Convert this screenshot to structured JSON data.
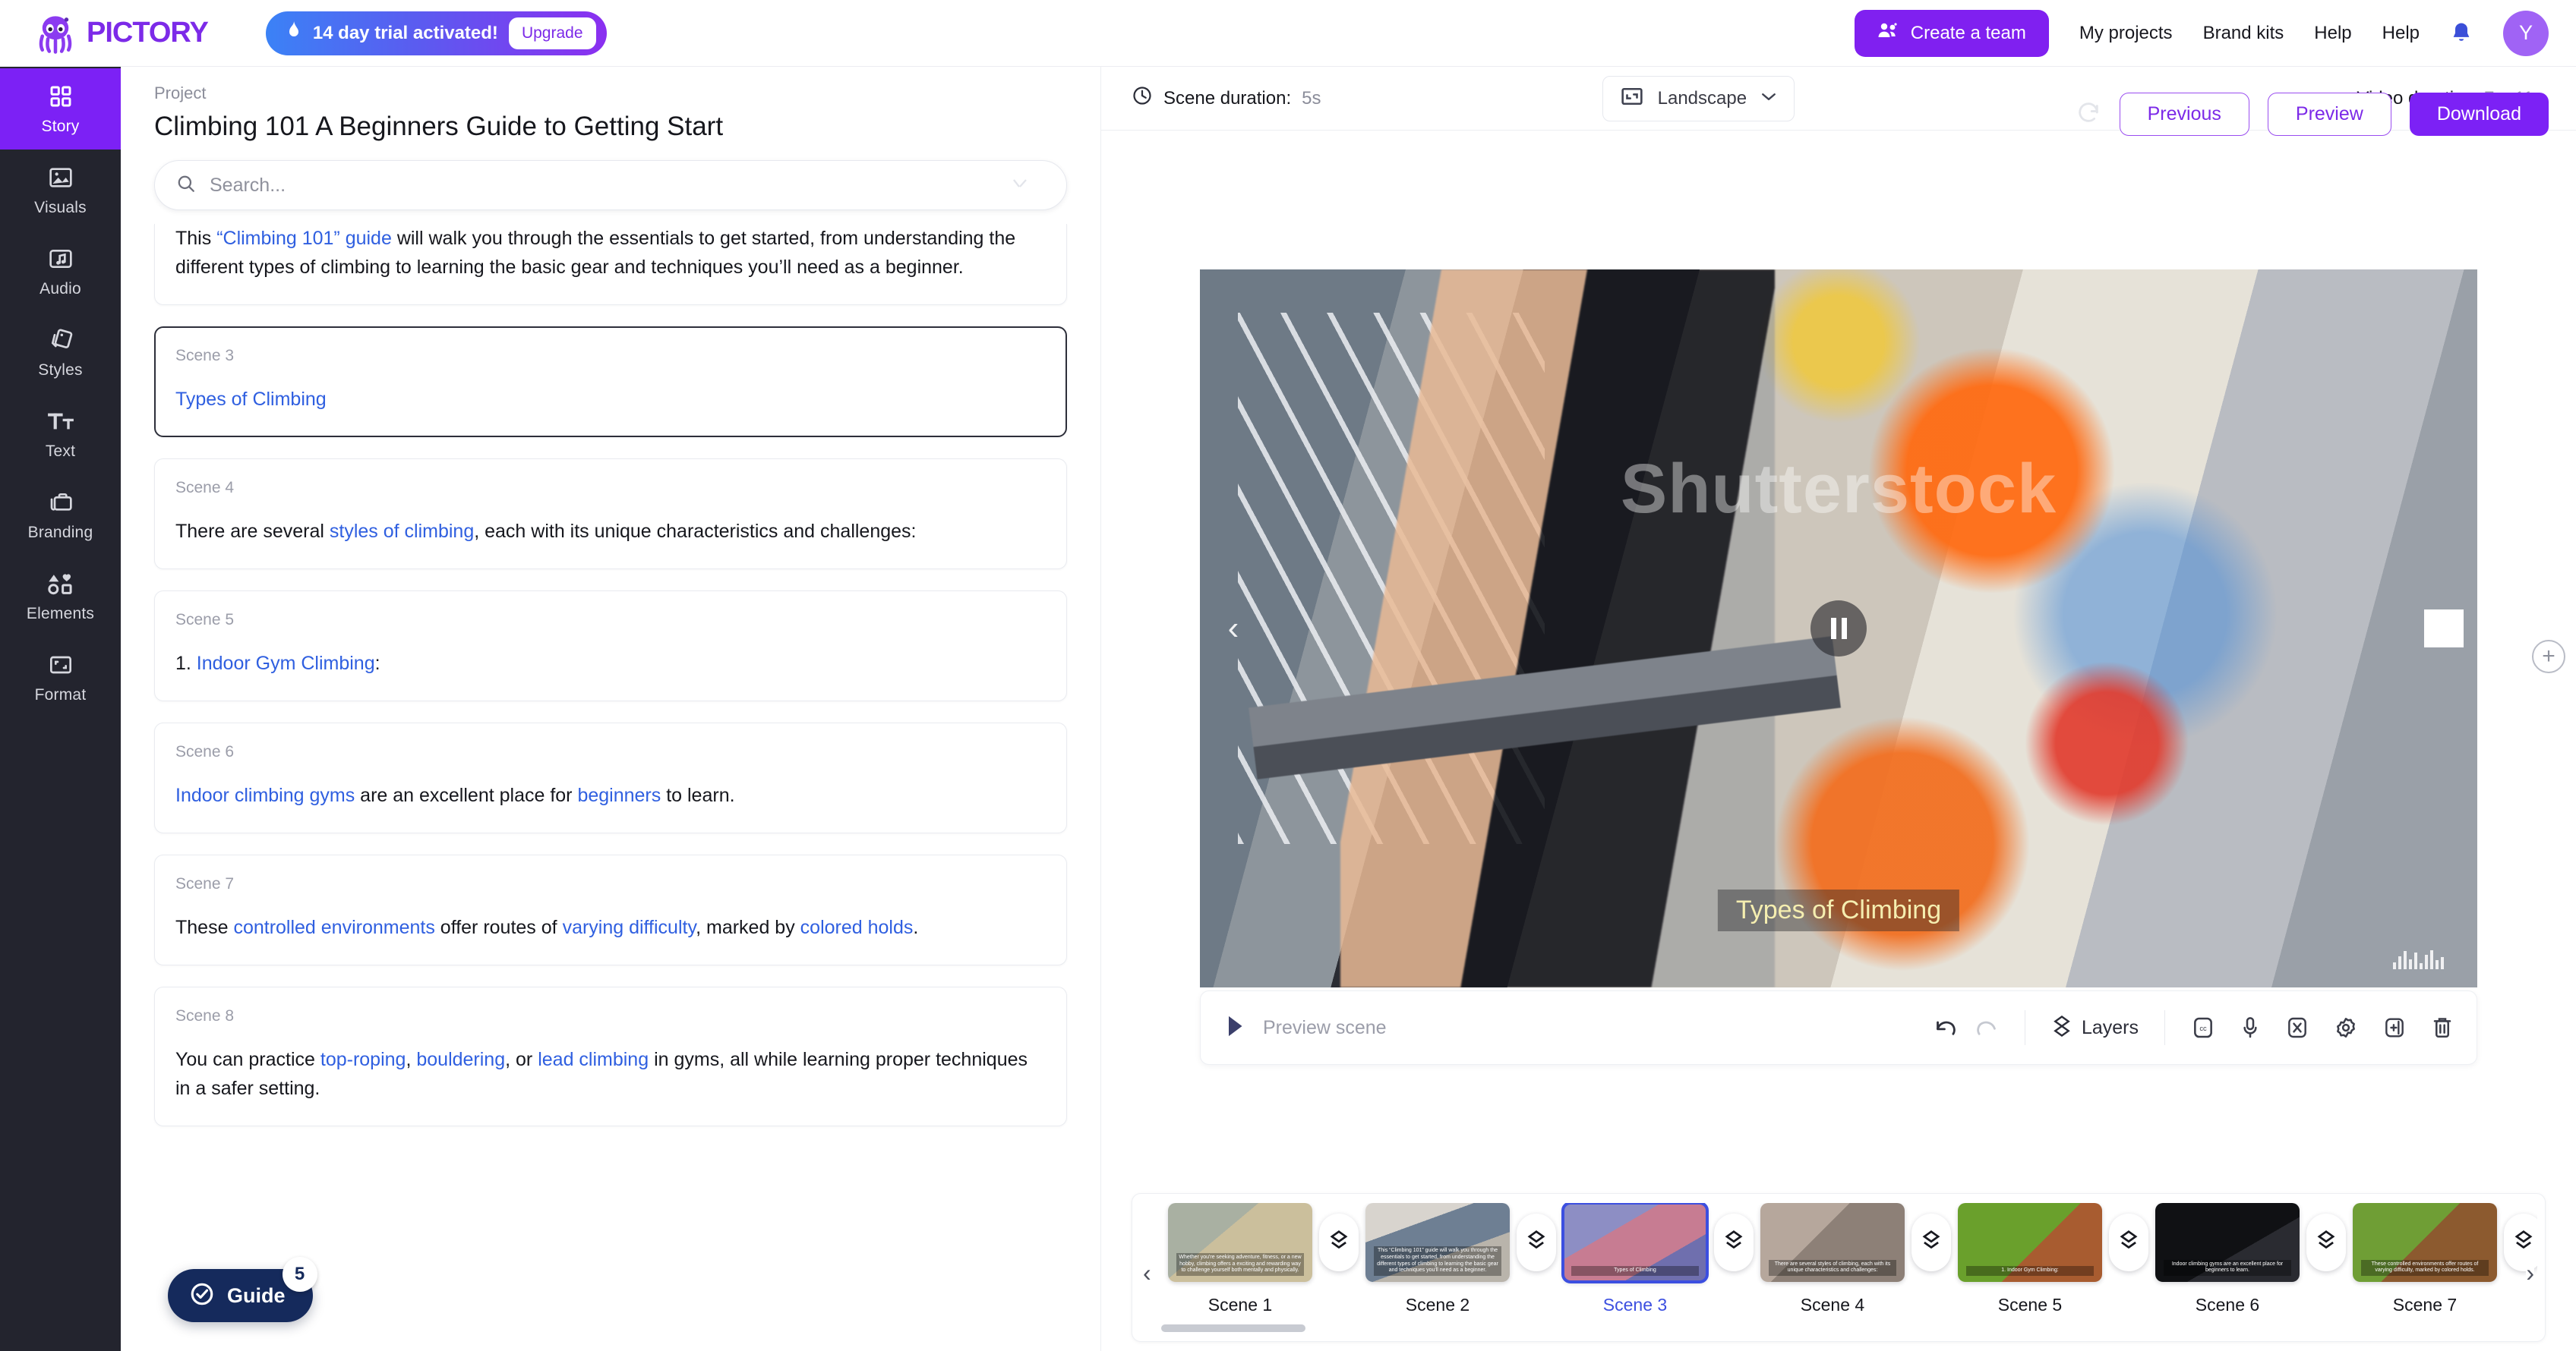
{
  "brand": {
    "name": "PICTORY",
    "logo_icon": "octopus-logo-icon",
    "accent": "#7c2ae8"
  },
  "trial": {
    "icon": "flame-icon",
    "text": "14 day trial activated!",
    "upgrade_label": "Upgrade"
  },
  "topnav": {
    "create_team_label": "Create a team",
    "create_team_icon": "team-icon",
    "links": [
      "My projects",
      "Brand kits",
      "Help",
      "Help"
    ],
    "bell_icon": "bell-icon",
    "avatar_initial": "Y"
  },
  "rail": {
    "items": [
      {
        "label": "Story",
        "icon": "grid-icon",
        "active": true
      },
      {
        "label": "Visuals",
        "icon": "image-icon",
        "active": false
      },
      {
        "label": "Audio",
        "icon": "music-note-icon",
        "active": false
      },
      {
        "label": "Styles",
        "icon": "cards-icon",
        "active": false
      },
      {
        "label": "Text",
        "icon": "text-size-icon",
        "active": false
      },
      {
        "label": "Branding",
        "icon": "briefcase-icon",
        "active": false
      },
      {
        "label": "Elements",
        "icon": "shapes-icon",
        "active": false
      },
      {
        "label": "Format",
        "icon": "frame-icon",
        "active": false
      }
    ]
  },
  "project": {
    "kicker": "Project",
    "title": "Climbing 101 A Beginners Guide to Getting Start",
    "sync_icon": "refresh-icon",
    "buttons": {
      "previous": "Previous",
      "preview": "Preview",
      "download": "Download"
    }
  },
  "search": {
    "placeholder": "Search...",
    "value": "",
    "icon": "search-icon",
    "collapse_icon": "collapse-icon"
  },
  "scenes": [
    {
      "number": "",
      "partial": true,
      "selected": false,
      "parts": [
        {
          "t": "This ",
          "hl": false
        },
        {
          "t": "“Climbing 101” guide",
          "hl": true
        },
        {
          "t": " will walk you through the essentials to get started, from understanding the different types of climbing to learning the basic gear and techniques you’ll need as a beginner.",
          "hl": false
        }
      ]
    },
    {
      "number": "Scene 3",
      "partial": false,
      "selected": true,
      "parts": [
        {
          "t": "Types of Climbing",
          "hl": true
        }
      ]
    },
    {
      "number": "Scene 4",
      "partial": false,
      "selected": false,
      "parts": [
        {
          "t": "There are several ",
          "hl": false
        },
        {
          "t": "styles of climbing",
          "hl": true
        },
        {
          "t": ", each with its unique characteristics and challenges:",
          "hl": false
        }
      ]
    },
    {
      "number": "Scene 5",
      "partial": false,
      "selected": false,
      "parts": [
        {
          "t": "1. ",
          "hl": false
        },
        {
          "t": "Indoor Gym Climbing",
          "hl": true
        },
        {
          "t": ":",
          "hl": false
        }
      ]
    },
    {
      "number": "Scene 6",
      "partial": false,
      "selected": false,
      "parts": [
        {
          "t": "Indoor climbing gyms",
          "hl": true
        },
        {
          "t": " are an excellent place for ",
          "hl": false
        },
        {
          "t": "beginners",
          "hl": true
        },
        {
          "t": " to learn.",
          "hl": false
        }
      ]
    },
    {
      "number": "Scene 7",
      "partial": false,
      "selected": false,
      "parts": [
        {
          "t": "These ",
          "hl": false
        },
        {
          "t": "controlled environments",
          "hl": true
        },
        {
          "t": " offer routes of ",
          "hl": false
        },
        {
          "t": "varying difficulty",
          "hl": true
        },
        {
          "t": ", marked by ",
          "hl": false
        },
        {
          "t": "colored holds",
          "hl": true
        },
        {
          "t": ".",
          "hl": false
        }
      ]
    },
    {
      "number": "Scene 8",
      "partial": false,
      "selected": false,
      "parts": [
        {
          "t": "You can practice ",
          "hl": false
        },
        {
          "t": "top-roping",
          "hl": true
        },
        {
          "t": ", ",
          "hl": false
        },
        {
          "t": "bouldering",
          "hl": true
        },
        {
          "t": ", or ",
          "hl": false
        },
        {
          "t": "lead climbing",
          "hl": true
        },
        {
          "t": " in gyms, all while learning proper techniques in a safer setting.",
          "hl": false
        }
      ]
    }
  ],
  "guide": {
    "label": "Guide",
    "badge": "5",
    "icon": "check-circle-icon"
  },
  "meta": {
    "scene_duration_label": "Scene duration:",
    "scene_duration_value": "5s",
    "clock_icon": "clock-icon",
    "ratio_label": "Landscape",
    "ratio_icon": "landscape-icon",
    "ratio_caret": "chevron-down-icon",
    "video_duration_label": "Video duration:",
    "video_duration_value": "7m 11s"
  },
  "player": {
    "watermark": "Shutterstock",
    "caption": "Types of Climbing",
    "state_icon": "pause-icon",
    "prev_icon": "chevron-left-icon",
    "next_icon": "chevron-right-icon",
    "add_left_icon": "plus-circle-icon",
    "add_right_icon": "plus-circle-icon",
    "waveform_icon": "audio-waveform-icon"
  },
  "toolbar": {
    "preview_scene_label": "Preview scene",
    "play_icon": "play-icon",
    "undo_icon": "undo-icon",
    "redo_icon": "redo-icon",
    "layers_label": "Layers",
    "layers_icon": "layers-icon",
    "icons": [
      "closed-caption-icon",
      "microphone-icon",
      "scissors-icon",
      "gear-icon",
      "duplicate-icon",
      "trash-icon"
    ]
  },
  "timeline": {
    "prev_icon": "chevron-left-icon",
    "next_icon": "chevron-right-icon",
    "split_icon": "split-scene-icon",
    "scenes": [
      {
        "label": "Scene 1",
        "selected": false,
        "caption": "Whether you're seeking adventure, fitness, or a new hobby, climbing offers a exciting and rewarding way to challenge yourself both mentally and physically.",
        "tone": "t1"
      },
      {
        "label": "Scene 2",
        "selected": false,
        "caption": "This “Climbing 101” guide will walk you through the essentials to get started, from understanding the different types of climbing to learning the basic gear and techniques you'll need as a beginner.",
        "tone": "t2"
      },
      {
        "label": "Scene 3",
        "selected": true,
        "caption": "Types of Climbing",
        "tone": "t3"
      },
      {
        "label": "Scene 4",
        "selected": false,
        "caption": "There are several styles of climbing, each with its unique characteristics and challenges:",
        "tone": "t4"
      },
      {
        "label": "Scene 5",
        "selected": false,
        "caption": "1. Indoor Gym Climbing:",
        "tone": "t5"
      },
      {
        "label": "Scene 6",
        "selected": false,
        "caption": "Indoor climbing gyms are an excellent place for beginners to learn.",
        "tone": "t6"
      },
      {
        "label": "Scene 7",
        "selected": false,
        "caption": "These controlled environments offer routes of varying difficulty, marked by colored holds.",
        "tone": "t7"
      }
    ]
  }
}
